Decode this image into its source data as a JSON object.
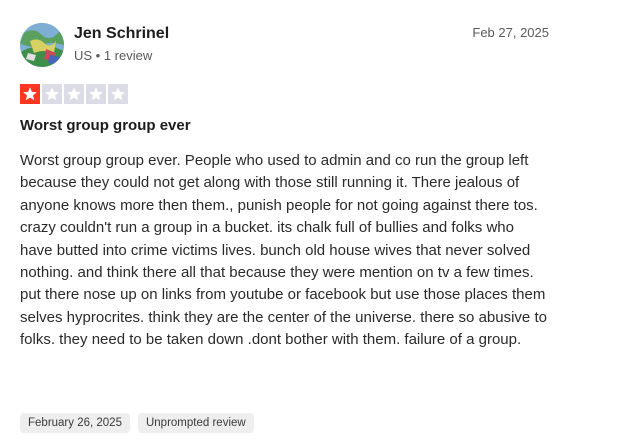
{
  "reviewer": {
    "name": "Jen Schrinel",
    "meta": "US • 1 review"
  },
  "review": {
    "date": "Feb 27, 2025",
    "rating": 1,
    "rating_max": 5,
    "title": "Worst group group ever",
    "body": "Worst group group ever. People who used to admin and co run the group left because they could not get along with those still running it. There jealous of anyone knows more then them., punish people for not going against there tos. crazy couldn't run a group in a bucket. its chalk full of bullies and folks who have butted into crime victims lives. bunch old house wives that never solved nothing. and think there all that because they were mention on tv a few times. put there nose up on links from youtube or facebook but use those places them selves hyprocrites. think they are the center of the universe. there so abusive to folks. they need to be taken down .dont bother with them. failure of a group."
  },
  "tags": {
    "experience_date": "February 26, 2025",
    "review_type": "Unprompted review"
  },
  "colors": {
    "star_filled": "#ff3722",
    "star_empty": "#dcdce6"
  },
  "icons": {
    "star": "star-icon",
    "avatar": "avatar"
  }
}
